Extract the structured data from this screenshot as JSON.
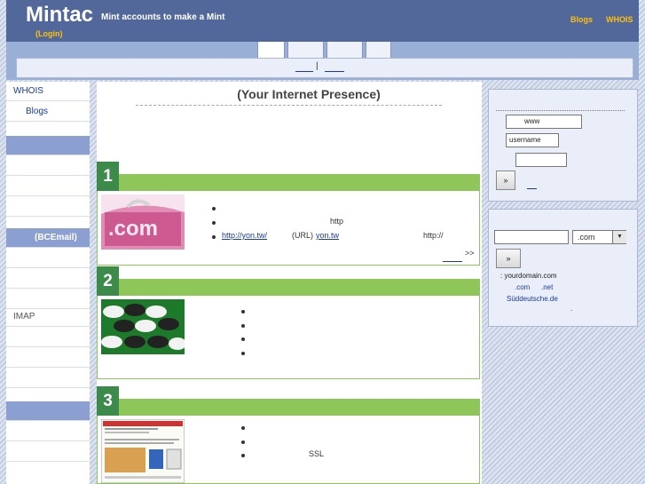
{
  "header": {
    "brand": "Mintac",
    "tagline": "Mint accounts to make a Mint",
    "login": "(Login)",
    "links": [
      "Blogs",
      "WHOIS"
    ]
  },
  "nav": {
    "separator": "|"
  },
  "sidebar": {
    "items": [
      {
        "label": "WHOIS"
      },
      {
        "label": "Blogs"
      },
      {
        "label": ""
      },
      {
        "label": ""
      },
      {
        "label": ""
      },
      {
        "label": ""
      },
      {
        "label": ""
      },
      {
        "label": "(BCEmail)"
      },
      {
        "label": ""
      },
      {
        "label": ""
      },
      {
        "label": ""
      },
      {
        "label": "IMAP"
      },
      {
        "label": ""
      },
      {
        "label": ""
      },
      {
        "label": ""
      },
      {
        "label": ""
      },
      {
        "label": ""
      },
      {
        "label": ""
      }
    ]
  },
  "main": {
    "title": "(Your Internet Presence)",
    "sections": [
      {
        "number": "1",
        "bullets": [
          {
            "text": ""
          },
          {
            "text": "http"
          },
          {
            "link1": "http://yon.tw/",
            "text": "(URL)",
            "link2": "yon.tw",
            "tail": "http://"
          }
        ],
        "more": ">>"
      },
      {
        "number": "2",
        "bullets": [
          {
            "text": ""
          },
          {
            "text": ""
          },
          {
            "text": ""
          },
          {
            "text": ""
          }
        ]
      },
      {
        "number": "3",
        "bullets": [
          {
            "text": ""
          },
          {
            "text": ""
          },
          {
            "text": "SSL"
          }
        ]
      }
    ]
  },
  "login_panel": {
    "www_prefix": "www",
    "username_value": "username",
    "password_value": "",
    "submit_label": "»"
  },
  "domain_panel": {
    "search_value": "",
    "tld_selected": ".com",
    "submit_label": "»",
    "example": ": yourdomain.com",
    "tld_examples": [
      ".com",
      ".net"
    ],
    "idn_example": "Süddeutsche.de",
    "dot": "."
  },
  "colors": {
    "header_bg": "#52689a",
    "nav_bg": "#9aafd6",
    "accent_green": "#8ec65a",
    "section_num_bg": "#3d8b4a",
    "link_yellow": "#ffc107",
    "link_blue": "#1a3a9c"
  }
}
